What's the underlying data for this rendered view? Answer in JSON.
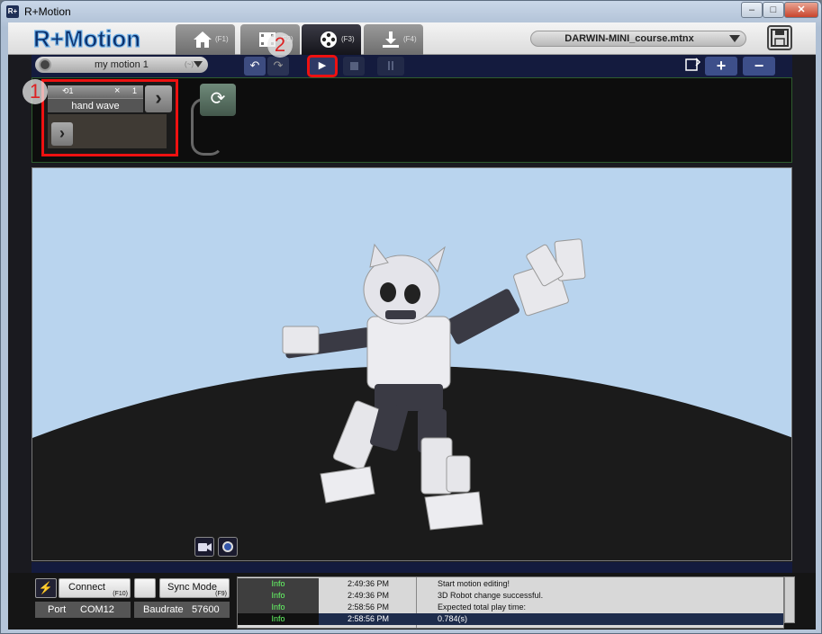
{
  "window": {
    "title": "R+Motion",
    "icon_text": "R+"
  },
  "header": {
    "logo": "R+Motion",
    "tabs": [
      {
        "key": "(F1)",
        "icon": "home-icon"
      },
      {
        "key": "(F2)",
        "icon": "film-icon"
      },
      {
        "key": "(F3)",
        "icon": "motion-reel-icon"
      },
      {
        "key": "(F4)",
        "icon": "download-icon"
      }
    ],
    "file_name": "DARWIN-MINI_course.mtnx"
  },
  "toolbar": {
    "motion_name": "my motion 1",
    "motion_hint": "(~)",
    "play_label": "▶"
  },
  "timeline": {
    "block": {
      "loop_count": "1",
      "times": "×",
      "times_count": "1",
      "name": "hand wave"
    }
  },
  "badges": {
    "one": "1",
    "two": "2"
  },
  "status": {
    "connect_label": "Connect",
    "connect_key": "(F10)",
    "sync_label": "Sync Mode",
    "sync_key": "(F9)",
    "port_key": "Port",
    "port_value": "COM12",
    "baud_key": "Baudrate",
    "baud_value": "57600"
  },
  "log": [
    {
      "level": "Info",
      "time": "2:49:36 PM",
      "message": "Start motion editing!"
    },
    {
      "level": "Info",
      "time": "2:49:36 PM",
      "message": "3D Robot change successful."
    },
    {
      "level": "Info",
      "time": "2:58:56 PM",
      "message": "Expected total play time:"
    },
    {
      "level": "Info",
      "time": "2:58:56 PM",
      "message": "0.784(s)"
    }
  ],
  "colors": {
    "accent_navy": "#141b3e",
    "highlight_red": "#e11111",
    "sky": "#b9d4ee"
  }
}
